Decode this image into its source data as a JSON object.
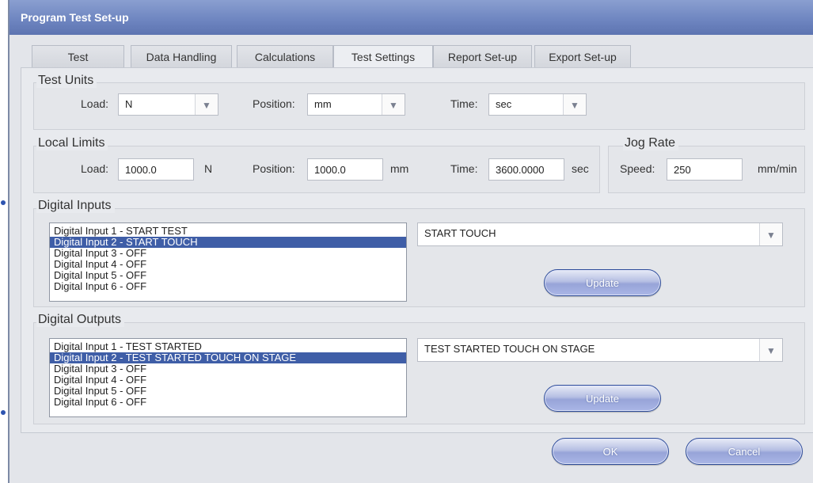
{
  "window": {
    "title": "Program Test Set-up"
  },
  "tabs": [
    {
      "label": "Test",
      "active": false
    },
    {
      "label": "Data Handling",
      "active": false
    },
    {
      "label": "Calculations",
      "active": false
    },
    {
      "label": "Test Settings",
      "active": true
    },
    {
      "label": "Report Set-up",
      "active": false
    },
    {
      "label": "Export Set-up",
      "active": false
    }
  ],
  "test_units": {
    "title": "Test Units",
    "load_label": "Load:",
    "load_value": "N",
    "position_label": "Position:",
    "position_value": "mm",
    "time_label": "Time:",
    "time_value": "sec"
  },
  "local_limits": {
    "title": "Local Limits",
    "load_label": "Load:",
    "load_value": "1000.0",
    "load_unit": "N",
    "position_label": "Position:",
    "position_value": "1000.0",
    "position_unit": "mm",
    "time_label": "Time:",
    "time_value": "3600.0000",
    "time_unit": "sec"
  },
  "jog_rate": {
    "title": "Jog Rate",
    "speed_label": "Speed:",
    "speed_value": "250",
    "speed_unit": "mm/min"
  },
  "digital_inputs": {
    "title": "Digital Inputs",
    "items": [
      "Digital Input 1 - START TEST",
      "Digital Input 2 - START TOUCH",
      "Digital Input 3 - OFF",
      "Digital Input 4 - OFF",
      "Digital Input 5 - OFF",
      "Digital Input 6 - OFF"
    ],
    "selected_index": 1,
    "dropdown_value": "START TOUCH",
    "update_label": "Update"
  },
  "digital_outputs": {
    "title": "Digital Outputs",
    "items": [
      "Digital Input 1 - TEST STARTED",
      "Digital Input 2 - TEST STARTED TOUCH ON STAGE",
      "Digital Input 3 - OFF",
      "Digital Input 4 - OFF",
      "Digital Input 5 - OFF",
      "Digital Input 6 - OFF"
    ],
    "selected_index": 1,
    "dropdown_value": "TEST STARTED TOUCH ON STAGE",
    "update_label": "Update"
  },
  "footer": {
    "ok_label": "OK",
    "cancel_label": "Cancel"
  },
  "icons": {
    "dropdown_arrow": "chevron-down-icon",
    "arrow_glyph": "▼"
  },
  "colors": {
    "titlebar": "#6f86c1",
    "selection": "#3f5ea7",
    "button_border": "#2f4d9b"
  }
}
